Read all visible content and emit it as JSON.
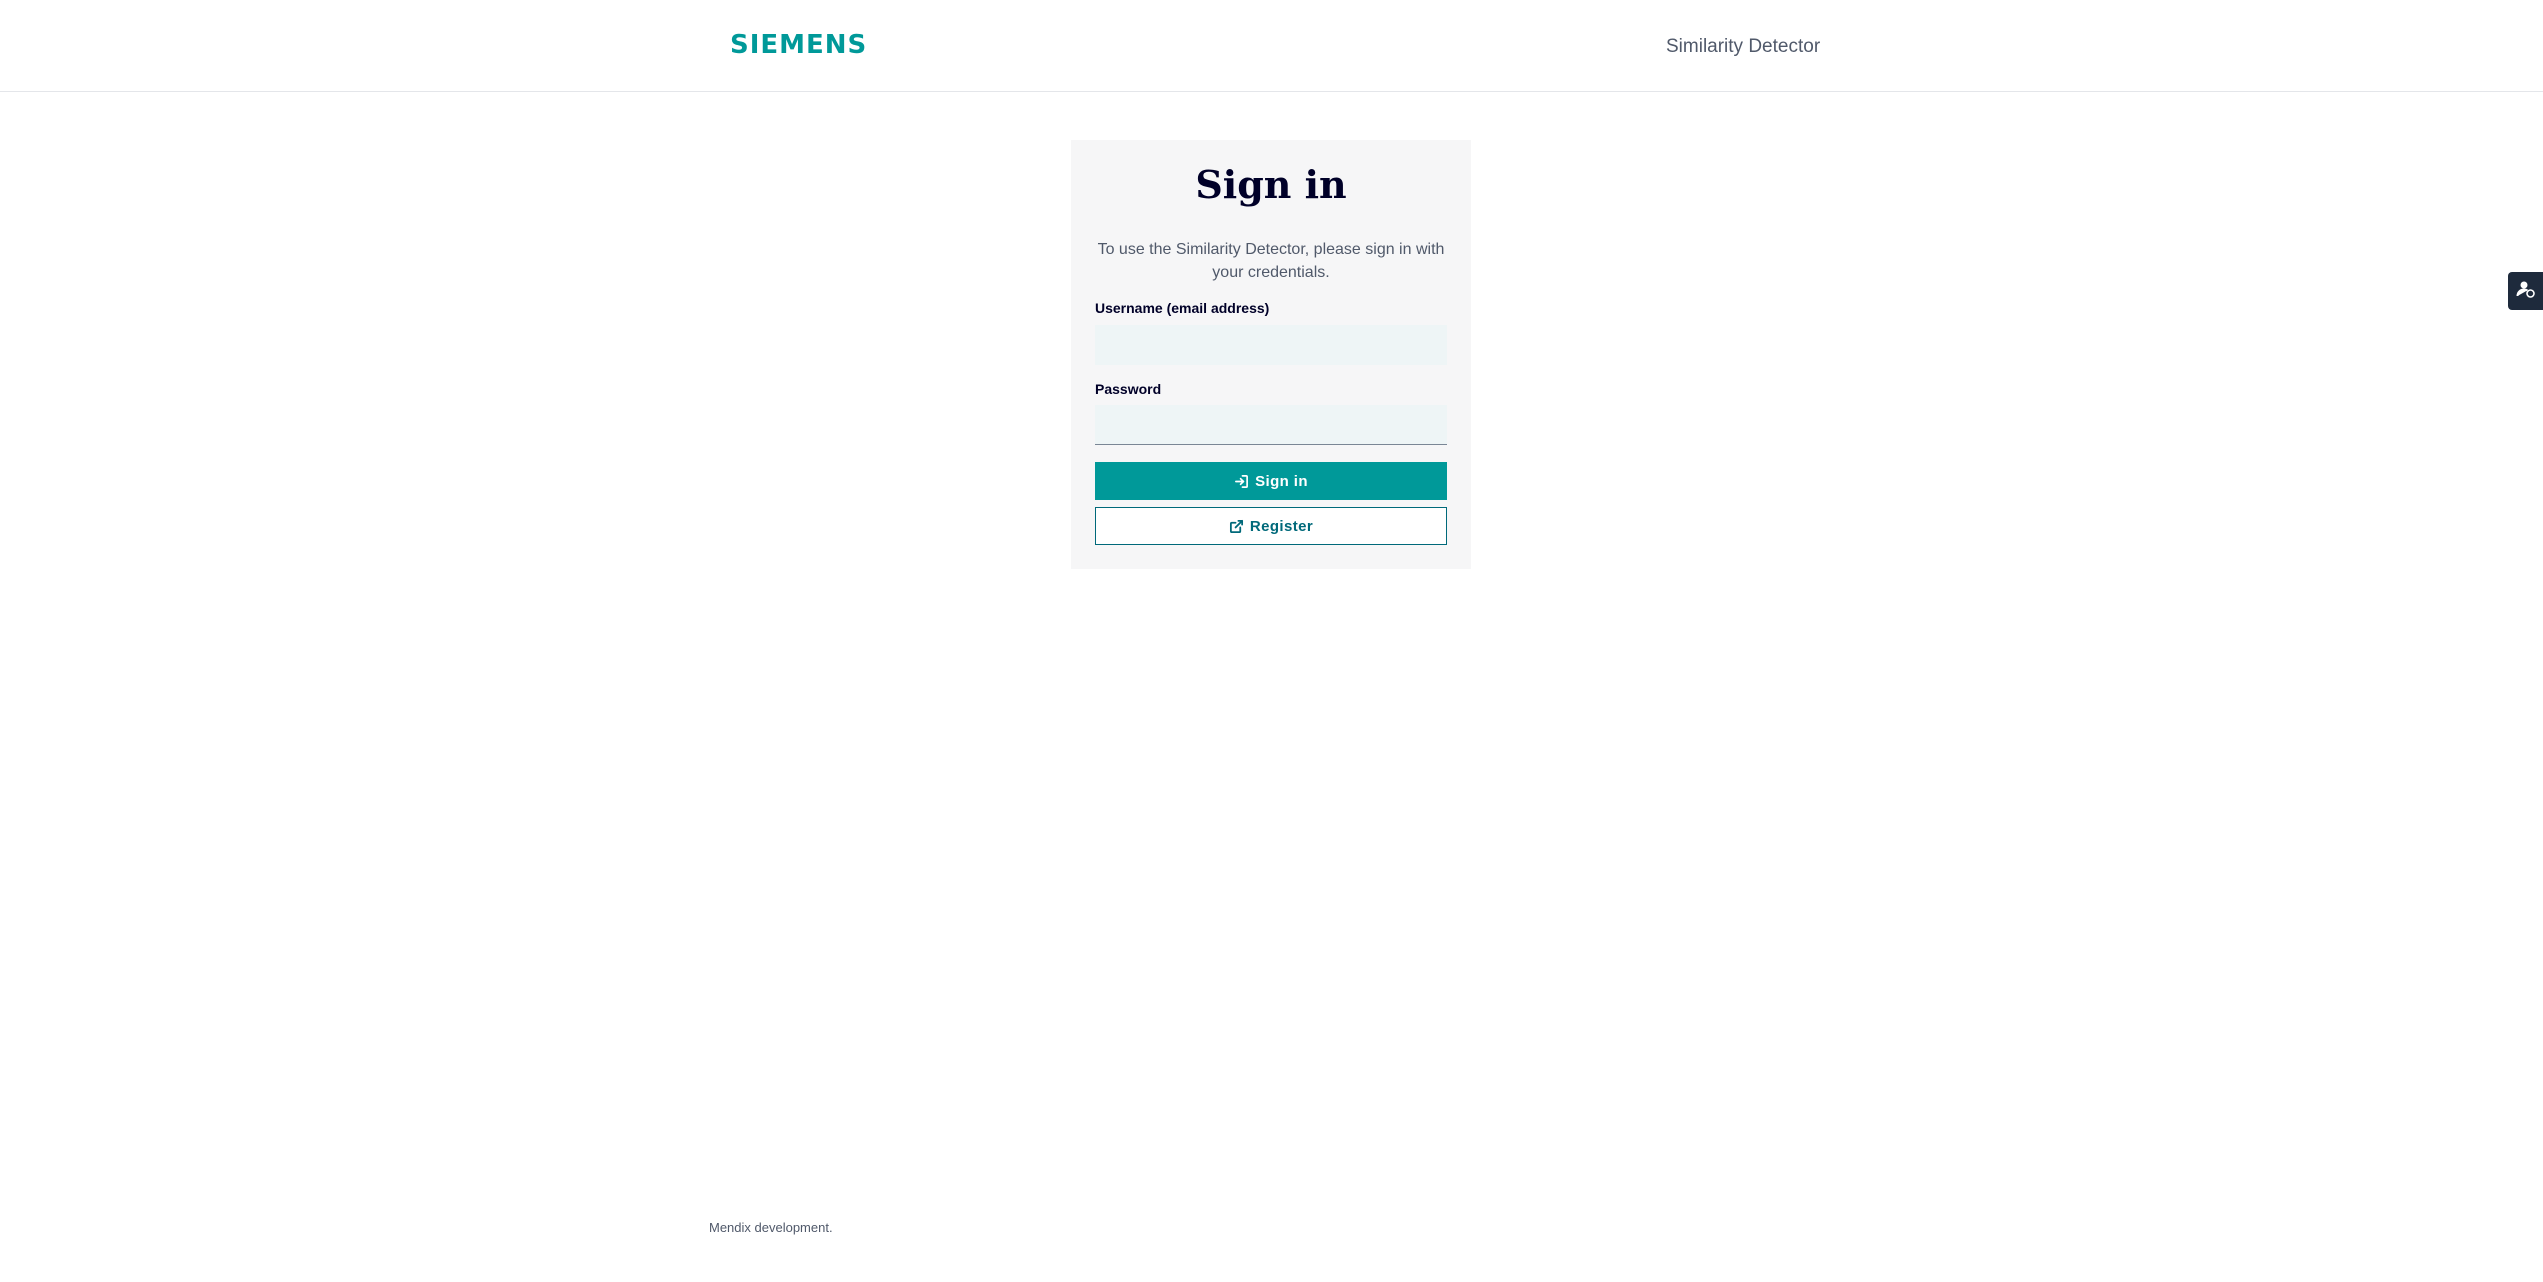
{
  "header": {
    "logo_text": "SIEMENS",
    "app_name": "Similarity Detector"
  },
  "signin": {
    "title": "Sign in",
    "intro": "To use the Similarity Detector, please sign in with your credentials.",
    "username_label": "Username (email address)",
    "username_value": "",
    "password_label": "Password",
    "password_value": "",
    "signin_label": "Sign in",
    "register_label": "Register"
  },
  "side_tab": {
    "icon": "user-feedback-icon"
  },
  "footer": {
    "note": "Mendix development."
  },
  "colors": {
    "brand": "#009999",
    "title": "#000028",
    "register_text": "#00697a",
    "side_tab": "#1e2a3c"
  },
  "icons": {
    "signin": "sign-in-icon",
    "register": "external-link-icon"
  }
}
